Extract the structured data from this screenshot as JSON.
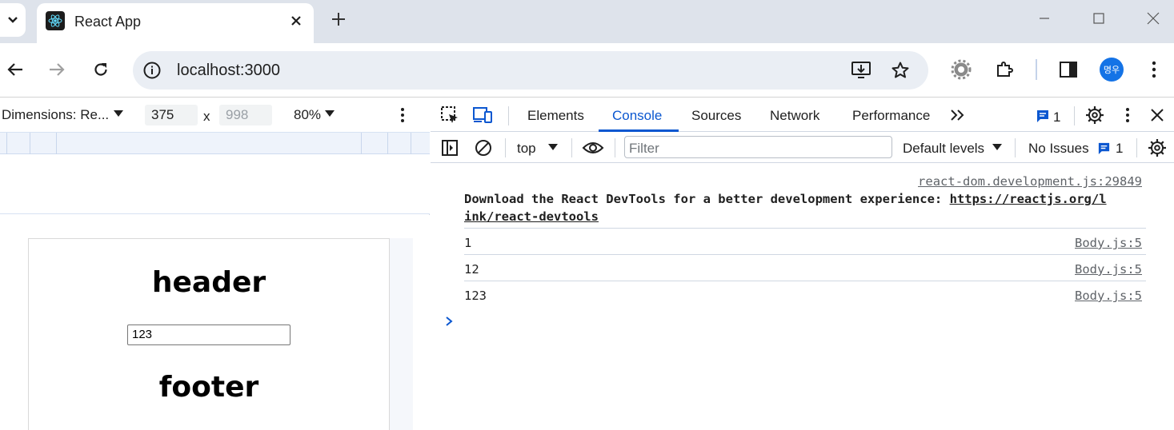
{
  "browser": {
    "tab": {
      "title": "React App",
      "close": "✕"
    },
    "new_tab": "+",
    "address": "localhost:3000",
    "avatar_text": "명우"
  },
  "device_toolbar": {
    "dimensions_label": "Dimensions: Re...",
    "width": "375",
    "height_placeholder": "998",
    "times": "x",
    "zoom": "80%"
  },
  "app": {
    "header": "header",
    "input_value": "123",
    "footer": "footer"
  },
  "devtools": {
    "tabs": [
      "Elements",
      "Console",
      "Sources",
      "Network",
      "Performance"
    ],
    "active_tab": "Console",
    "message_badge_count": "1",
    "context": "top",
    "filter_placeholder": "Filter",
    "levels": "Default levels",
    "issues_label": "No Issues",
    "issues_count": "1",
    "console": {
      "devtools_msg": {
        "source": "react-dom.development.js:29849",
        "text": "Download the React DevTools for a better development experience: ",
        "link_part1": "https://reactjs.org/l",
        "link_part2": "ink/react-devtools"
      },
      "logs": [
        {
          "text": "1",
          "source": "Body.js:5"
        },
        {
          "text": "12",
          "source": "Body.js:5"
        },
        {
          "text": "123",
          "source": "Body.js:5"
        }
      ]
    }
  },
  "colors": {
    "accent": "#0b57d0",
    "tabstrip": "#dee3eb",
    "omnibox": "#eaeef4"
  }
}
